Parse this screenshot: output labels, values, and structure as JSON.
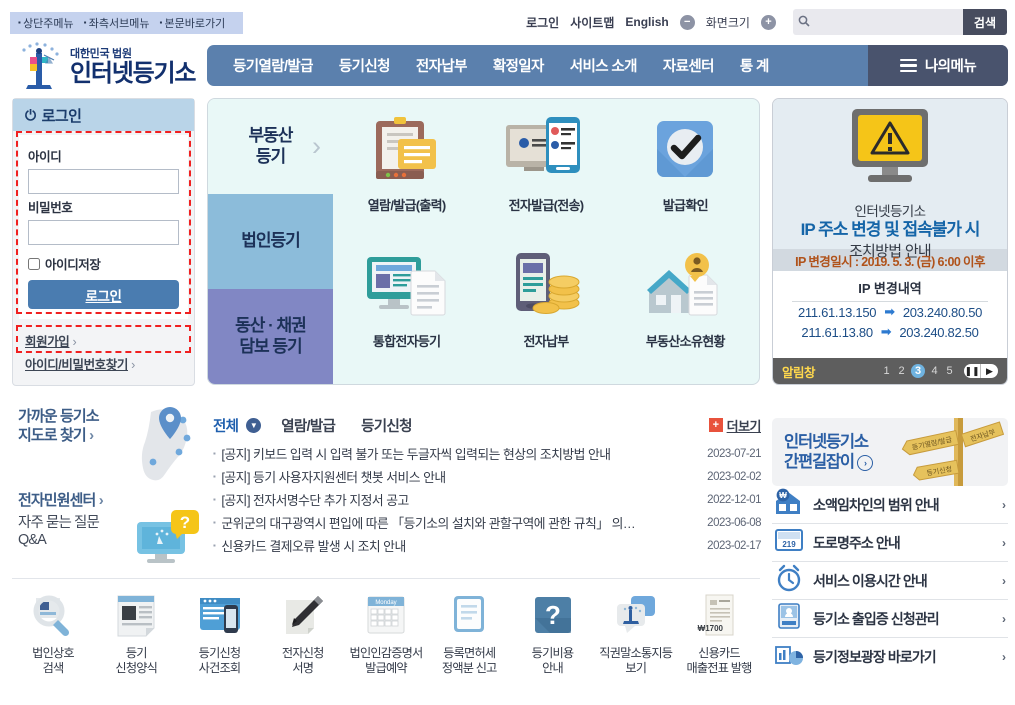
{
  "skip_links": [
    "상단주메뉴",
    "좌측서브메뉴",
    "본문바로가기"
  ],
  "utility": {
    "login": "로그인",
    "sitemap": "사이트맵",
    "english": "English",
    "zoom_out": "−",
    "zoom_label": "화면크기",
    "zoom_in": "+",
    "search_placeholder": "",
    "search_value": "",
    "search_button": "검색",
    "search_icon": "search-icon"
  },
  "logo": {
    "line1": "대한민국 법원",
    "line2": "인터넷등기소"
  },
  "gnb": {
    "items": [
      {
        "label": "등기열람/발급"
      },
      {
        "label": "등기신청"
      },
      {
        "label": "전자납부"
      },
      {
        "label": "확정일자"
      },
      {
        "label": "서비스 소개"
      },
      {
        "label": "자료센터"
      },
      {
        "label": "통 계"
      }
    ],
    "mymenu": "나의메뉴"
  },
  "login_panel": {
    "title": "로그인",
    "id_label": "아이디",
    "id_value": "",
    "pw_label": "비밀번호",
    "pw_value": "",
    "save_id": "아이디저장",
    "submit": "로그인",
    "join": "회원가입",
    "find": "아이디/비밀번호찾기",
    "arrow": "›"
  },
  "hero": {
    "categories": [
      {
        "label": "부동산\n등기",
        "line1": "부동산",
        "line2": "등기",
        "active": true
      },
      {
        "label": "법인등기",
        "line1": "법인등기",
        "line2": "",
        "active": false
      },
      {
        "label": "동산·채권 담보 등기",
        "line1": "동산 · 채권",
        "line2": "담보 등기",
        "active": false
      }
    ],
    "chevron": "›",
    "tiles": [
      {
        "label": "열람/발급(출력)",
        "icon": "clipboard-document-icon"
      },
      {
        "label": "전자발급(전송)",
        "icon": "monitor-mobile-icon"
      },
      {
        "label": "발급확인",
        "icon": "check-badge-icon"
      },
      {
        "label": "통합전자등기",
        "icon": "desktop-document-icon"
      },
      {
        "label": "전자납부",
        "icon": "mobile-coins-icon"
      },
      {
        "label": "부동산소유현황",
        "icon": "house-person-icon"
      }
    ]
  },
  "alert_panel": {
    "icon": "warning-monitor-icon",
    "title1": "인터넷등기소",
    "title2": "IP 주소 변경 및 접속불가 시",
    "title3": "조치방법 안내",
    "band": "IP 변경일시 : 2019. 5. 3. (금) 6:00 이후",
    "detail_title": "IP 변경내역",
    "ip_rows": [
      {
        "from": "211.61.13.150",
        "arrow": "➡",
        "to": "203.240.80.50"
      },
      {
        "from": "211.61.13.80",
        "arrow": "➡",
        "to": "203.240.82.50"
      }
    ],
    "bar_label": "알림창",
    "pages": [
      "1",
      "2",
      "3",
      "4",
      "5"
    ],
    "active_page": "3",
    "pause": "❚❚",
    "next": "▶"
  },
  "widgets": [
    {
      "line1": "가까운 등기소",
      "line2": "지도로 찾기",
      "arrow": "›",
      "sub": "",
      "icon": "korea-map-pin-icon"
    },
    {
      "line1": "전자민원센터",
      "line2": "",
      "arrow": "›",
      "sub": "자주 묻는 질문\nQ&A",
      "sub1": "자주 묻는 질문",
      "sub2": "Q&A",
      "icon": "help-monitor-icon"
    }
  ],
  "notices": {
    "tabs": [
      {
        "label": "전체",
        "active": true
      },
      {
        "label": "열람/발급",
        "active": false
      },
      {
        "label": "등기신청",
        "active": false
      }
    ],
    "more": "더보기",
    "more_plus": "+",
    "items": [
      {
        "title": "[공지] 키보드 입력 시 입력 불가 또는 두글자씩 입력되는 현상의 조치방법 안내",
        "date": "2023-07-21"
      },
      {
        "title": "[공지] 등기 사용자지원센터 챗봇 서비스 안내",
        "date": "2023-02-02"
      },
      {
        "title": "[공지] 전자서명수단 추가 지정서 공고",
        "date": "2022-12-01"
      },
      {
        "title": "군위군의 대구광역시 편입에 따른 「등기소의 설치와 관할구역에 관한 규칙」 의…",
        "date": "2023-06-08"
      },
      {
        "title": "신용카드 결제오류 발생 시 조치 안내",
        "date": "2023-02-17"
      }
    ]
  },
  "quick": {
    "banner_line1": "인터넷등기소",
    "banner_line2": "간편길잡이",
    "banner_arrow": "›",
    "banner_icon": "signpost-icon",
    "signs": [
      "등기열람/발급",
      "전자납부",
      "등기신청"
    ],
    "links": [
      {
        "label": "소액임차인의 범위 안내",
        "arrow": "›",
        "icon": "house-won-icon"
      },
      {
        "label": "도로명주소 안내",
        "arrow": "›",
        "icon": "address-plate-icon"
      },
      {
        "label": "서비스 이용시간 안내",
        "arrow": "›",
        "icon": "alarm-clock-icon"
      },
      {
        "label": "등기소 출입증 신청관리",
        "arrow": "›",
        "icon": "id-badge-icon"
      },
      {
        "label": "등기정보광장 바로가기",
        "arrow": "›",
        "icon": "chart-pie-icon"
      }
    ]
  },
  "bottom_icons": [
    {
      "line1": "법인상호",
      "line2": "검색",
      "icon": "magnifier-search-icon"
    },
    {
      "line1": "등기",
      "line2": "신청양식",
      "icon": "form-document-icon"
    },
    {
      "line1": "등기신청",
      "line2": "사건조회",
      "icon": "browser-mobile-icon"
    },
    {
      "line1": "전자신청",
      "line2": "서명",
      "icon": "pen-sign-icon"
    },
    {
      "line1": "법인인감증명서",
      "line2": "발급예약",
      "icon": "calendar-icon",
      "calendar_label": "Monday"
    },
    {
      "line1": "등록면허세",
      "line2": "정액분 신고",
      "icon": "document-lines-icon"
    },
    {
      "line1": "등기비용",
      "line2": "안내",
      "icon": "question-mark-icon"
    },
    {
      "line1": "직권말소통지등",
      "line2": "보기",
      "icon": "speech-bubble-icon"
    },
    {
      "line1": "신용카드",
      "line2": "매출전표 발행",
      "icon": "receipt-icon",
      "receipt_amount": "₩1700"
    }
  ],
  "colors": {
    "nav_blue": "#5b80ad",
    "mymenu_dark": "#49536d",
    "accent_blue": "#1f5fae",
    "alert_orange": "#b0521a",
    "annotation_red": "#f02020"
  }
}
